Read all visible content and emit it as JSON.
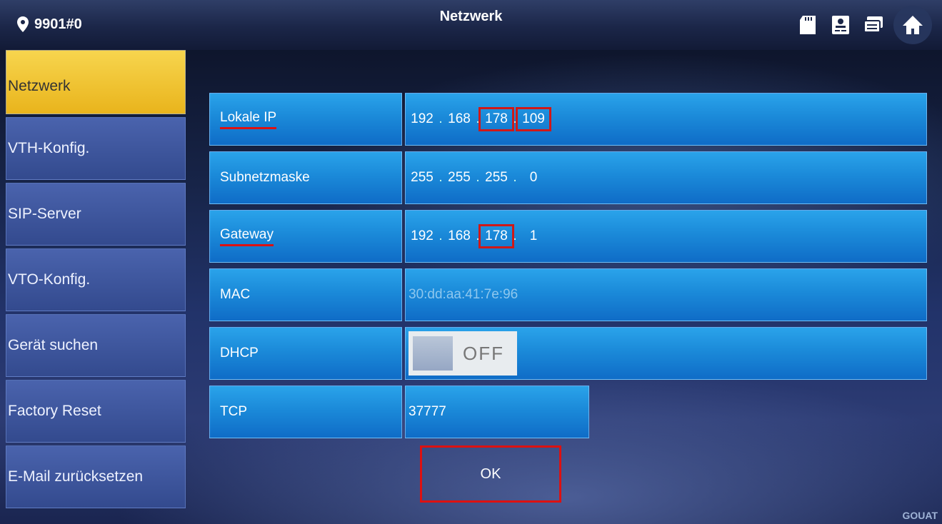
{
  "header": {
    "device_id": "9901#0",
    "title": "Netzwerk"
  },
  "top_icons": [
    "sd-card-icon",
    "contact-card-icon",
    "message-stack-icon",
    "home-icon"
  ],
  "sidebar": {
    "items": [
      {
        "label": "Netzwerk",
        "active": true
      },
      {
        "label": "VTH-Konfig."
      },
      {
        "label": "SIP-Server"
      },
      {
        "label": "VTO-Konfig."
      },
      {
        "label": "Gerät suchen"
      },
      {
        "label": "Factory Reset"
      },
      {
        "label": "E-Mail zurücksetzen"
      }
    ]
  },
  "form": {
    "local_ip": {
      "label": "Lokale IP",
      "octets": [
        "192",
        "168",
        "178",
        "109"
      ]
    },
    "subnet": {
      "label": "Subnetzmaske",
      "octets": [
        "255",
        "255",
        "255",
        "0"
      ]
    },
    "gateway": {
      "label": "Gateway",
      "octets": [
        "192",
        "168",
        "178",
        "1"
      ]
    },
    "mac": {
      "label": "MAC",
      "value": "30:dd:aa:41:7e:96"
    },
    "dhcp": {
      "label": "DHCP",
      "state": "OFF"
    },
    "tcp": {
      "label": "TCP",
      "value": "37777"
    }
  },
  "actions": {
    "ok_label": "OK"
  },
  "brand": "GOUAT",
  "colors": {
    "accent": "#f2c630",
    "field": "#1b8ad9",
    "highlight": "#d11818"
  }
}
